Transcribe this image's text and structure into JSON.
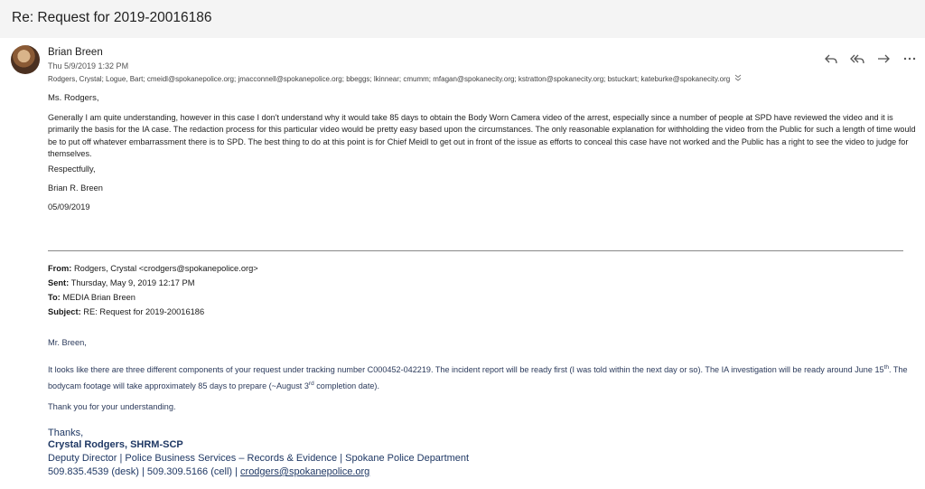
{
  "subject": "Re: Request for 2019-20016186",
  "message": {
    "sender": "Brian Breen",
    "date": "Thu 5/9/2019 1:32 PM",
    "recipients": "Rodgers, Crystal; Logue, Bart; cmeidl@spokanepolice.org; jmacconnell@spokanepolice.org; bbeggs; lkinnear; cmumm; mfagan@spokanecity.org; kstratton@spokanecity.org; bstuckart; kateburke@spokanecity.org",
    "expand_icon": "chevron-double-down",
    "greeting": "Ms. Rodgers,",
    "paragraph": "Generally I am quite understanding, however in this case I don't understand why it would take 85 days to obtain the Body Worn Camera video of the arrest, especially since a number of people at SPD have reviewed the video and it is primarily the basis for the IA case. The redaction process for this particular video would be pretty easy based upon the circumstances. The only reasonable explanation for withholding the video from the Public for such a length of time would be to put off whatever embarrassment there is to SPD. The best thing to do at this point is for Chief Meidl to get out in front of the issue as efforts to conceal this case have not worked and the Public has a right to see the video to judge for themselves.",
    "closing": "Respectfully,",
    "signature_name": "Brian R. Breen",
    "signature_date": "05/09/2019"
  },
  "actions": {
    "reply": "reply-icon",
    "reply_all": "reply-all-icon",
    "forward": "forward-icon",
    "more": "more-icon"
  },
  "quoted": {
    "from_label": "From:",
    "from": "Rodgers, Crystal <crodgers@spokanepolice.org>",
    "sent_label": "Sent:",
    "sent": "Thursday, May 9, 2019 12:17 PM",
    "to_label": "To:",
    "to": "MEDIA Brian Breen",
    "subject_label": "Subject:",
    "subject": "RE: Request for 2019-20016186",
    "greeting": "Mr. Breen,",
    "para_part1": "It looks like there are three different components of your request under tracking number C000452-042219. The incident report will be ready first (I was told within the next day or so). The IA investigation will be ready around June 15",
    "para_sup1": "th",
    "para_part2": ". The bodycam footage will take approximately 85 days to prepare (~August 3",
    "para_sup2": "rd",
    "para_part3": " completion date).",
    "thanks_line": "Thank you for your understanding.",
    "sig_thanks": "Thanks,",
    "sig_name": "Crystal Rodgers, SHRM-SCP",
    "sig_title": "Deputy Director | Police Business Services – Records & Evidence | Spokane Police Department",
    "sig_phone": "509.835.4539 (desk) | 509.309.5166 (cell) | ",
    "sig_email": "crodgers@spokanepolice.org"
  }
}
